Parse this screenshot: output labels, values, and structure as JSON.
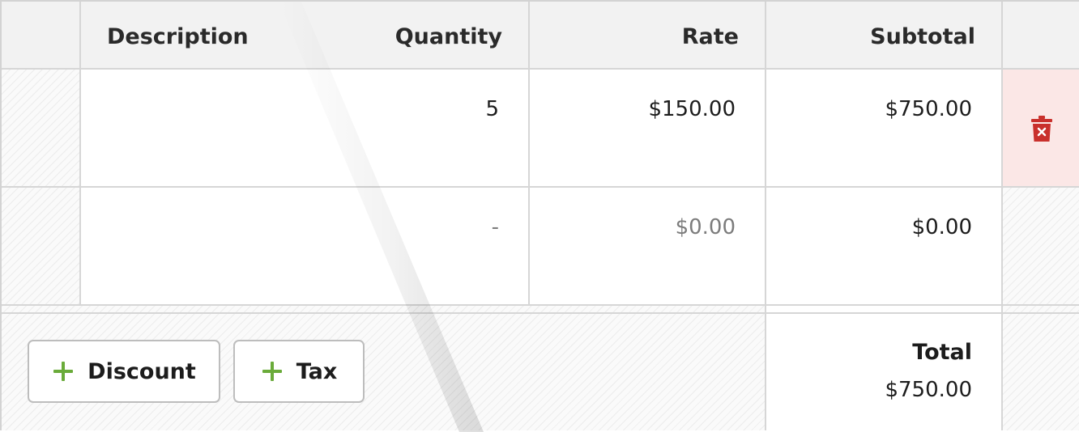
{
  "table": {
    "headers": {
      "description": "Description",
      "quantity": "Quantity",
      "rate": "Rate",
      "subtotal": "Subtotal"
    },
    "rows": [
      {
        "description": "",
        "quantity": "5",
        "rate": "$150.00",
        "subtotal": "$750.00",
        "delete_icon": "trash-icon"
      },
      {
        "description": "",
        "quantity": "-",
        "rate": "$0.00",
        "subtotal": "$0.00"
      }
    ]
  },
  "actions": {
    "discount_label": "Discount",
    "tax_label": "Tax",
    "add_icon": "plus-icon"
  },
  "summary": {
    "total_label": "Total",
    "total_value": "$750.00"
  },
  "colors": {
    "add_icon": "#6aab3a",
    "delete_icon": "#c9302c",
    "delete_cell_bg": "#fbe7e6",
    "header_bg": "#f2f2f2"
  }
}
